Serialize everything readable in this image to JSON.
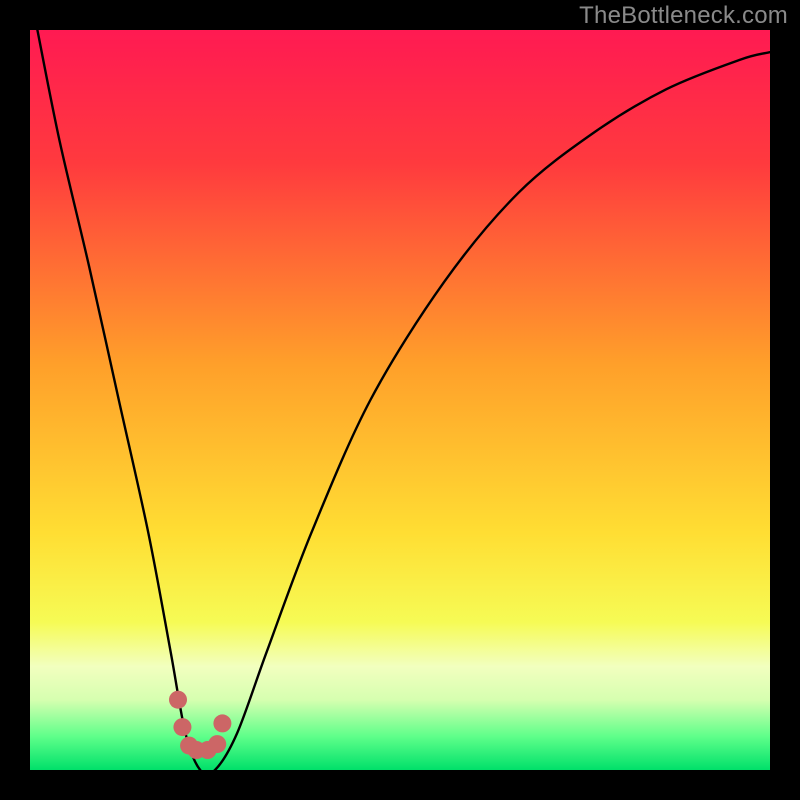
{
  "watermark": "TheBottleneck.com",
  "chart_data": {
    "type": "line",
    "title": "",
    "xlabel": "",
    "ylabel": "",
    "xlim": [
      0,
      100
    ],
    "ylim": [
      0,
      100
    ],
    "gradient_stops": [
      {
        "offset": 0,
        "color": "#ff1a52"
      },
      {
        "offset": 0.18,
        "color": "#ff3a3e"
      },
      {
        "offset": 0.45,
        "color": "#ff9f2a"
      },
      {
        "offset": 0.68,
        "color": "#ffde33"
      },
      {
        "offset": 0.8,
        "color": "#f6fb55"
      },
      {
        "offset": 0.86,
        "color": "#f2ffbf"
      },
      {
        "offset": 0.905,
        "color": "#d6ffb0"
      },
      {
        "offset": 0.955,
        "color": "#5eff8a"
      },
      {
        "offset": 1.0,
        "color": "#00e06a"
      }
    ],
    "series": [
      {
        "name": "bottleneck-curve",
        "x": [
          1,
          4,
          8,
          12,
          16,
          19,
          21,
          23,
          25,
          28,
          32,
          38,
          46,
          56,
          66,
          76,
          86,
          96,
          100
        ],
        "values": [
          100,
          85,
          68,
          50,
          32,
          16,
          5,
          0,
          0,
          5,
          16,
          32,
          50,
          66,
          78,
          86,
          92,
          96,
          97
        ]
      }
    ],
    "markers": {
      "name": "highlight-points",
      "color": "#cc6666",
      "x": [
        20.0,
        20.6,
        21.5,
        22.5,
        24.0,
        25.3,
        26.0
      ],
      "values": [
        9.5,
        5.8,
        3.3,
        2.7,
        2.7,
        3.5,
        6.3
      ]
    }
  }
}
